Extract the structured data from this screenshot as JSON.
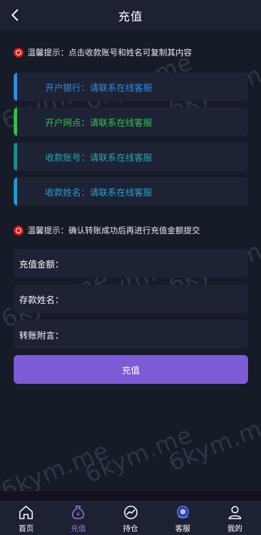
{
  "header": {
    "title": "充值"
  },
  "notice1": {
    "text": "温馨提示：点击收款账号和姓名可复制其内容"
  },
  "info_cards": [
    {
      "text": "开户银行：请联系在线客服",
      "color": "#2e8ee8",
      "bar": "#2e8ee8"
    },
    {
      "text": "开户网点：请联系在线客服",
      "color": "#33c24e",
      "bar": "#2fbf52"
    },
    {
      "text": "收款账号：请联系在线客服",
      "color": "#2aa4b8",
      "bar": "#1a8f8a"
    },
    {
      "text": "收款姓名：请联系在线客服",
      "color": "#2a9fd8",
      "bar": "#1e9ad6"
    }
  ],
  "notice2": {
    "text": "温馨提示：确认转账成功后再进行充值金额提交"
  },
  "form": {
    "amount_label": "充值金额：",
    "name_label": "存款姓名：",
    "note_label": "转账附言："
  },
  "submit_label": "充值",
  "watermark": "6kym.me",
  "tabs": [
    {
      "label": "首页",
      "icon": "home-icon"
    },
    {
      "label": "充值",
      "icon": "money-bag-icon"
    },
    {
      "label": "持仓",
      "icon": "chart-icon"
    },
    {
      "label": "客服",
      "icon": "support-icon"
    },
    {
      "label": "我的",
      "icon": "user-icon"
    }
  ],
  "colors": {
    "accent": "#7c5bd6",
    "background": "#161b28",
    "card": "#1d2334",
    "alert": "#e01818"
  }
}
